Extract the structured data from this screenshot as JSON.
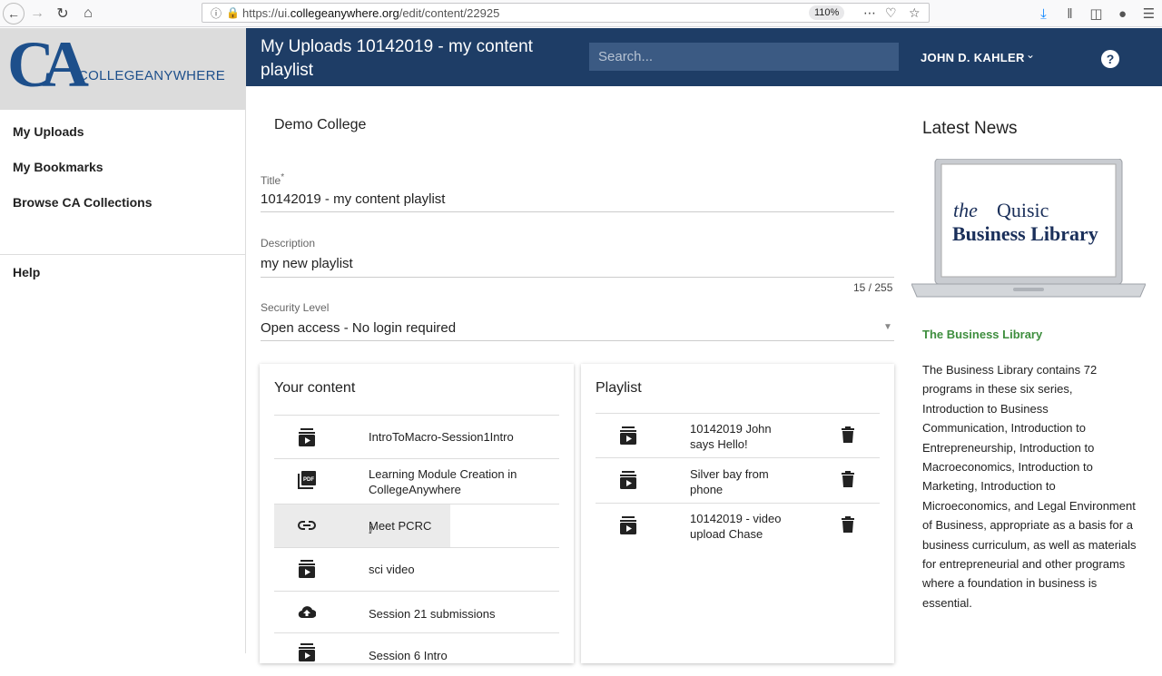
{
  "browser": {
    "url_prefix": "https://ui.",
    "url_domain": "collegeanywhere.org",
    "url_path": "/edit/content/22925",
    "zoom": "110%"
  },
  "sidebar": {
    "logo_letters": "CA",
    "logo_text": "COLLEGEANYWHERE",
    "items": [
      {
        "label": "My Uploads"
      },
      {
        "label": "My Bookmarks"
      },
      {
        "label": "Browse CA Collections"
      },
      {
        "label": "Help"
      }
    ]
  },
  "header": {
    "title": "My Uploads 10142019 - my content playlist",
    "search_placeholder": "Search...",
    "user": "JOHN D. KAHLER",
    "help": "?"
  },
  "form": {
    "college": "Demo College",
    "title_label": "Title",
    "title_required": "*",
    "title_value": "10142019 - my content playlist",
    "description_label": "Description",
    "description_value": "my new playlist",
    "description_counter": "15 / 255",
    "security_label": "Security Level",
    "security_value": "Open access - No login required"
  },
  "your_content": {
    "title": "Your content",
    "items": [
      {
        "label": "IntroToMacro-Session1Intro",
        "icon": "video-stack-icon"
      },
      {
        "label": "Learning Module Creation in CollegeAnywhere",
        "icon": "pdf-icon"
      },
      {
        "label": "Meet PCRC",
        "icon": "link-icon"
      },
      {
        "label": "sci video",
        "icon": "video-stack-icon"
      },
      {
        "label": "Session 21 submissions",
        "icon": "cloud-upload-icon"
      },
      {
        "label": "Session 6 Intro",
        "icon": "video-stack-icon"
      }
    ]
  },
  "playlist": {
    "title": "Playlist",
    "items": [
      {
        "label": "10142019 John says Hello!"
      },
      {
        "label": "Silver bay from phone"
      },
      {
        "label": "10142019 - video upload Chase"
      }
    ]
  },
  "news": {
    "title": "Latest News",
    "image_line1_a": "the",
    "image_line1_b": "Quisic",
    "image_line2": "Business Library",
    "link": "The Business Library",
    "body": "The Business Library contains 72 programs in these six series, Introduction to Business Communication, Introduction to Entrepreneurship, Introduction to Macroeconomics, Introduction to Marketing, Introduction to Microeconomics, and Legal Environment of Business, appropriate as a basis for a business curriculum, as well as materials for entrepreneurial and other programs where a foundation in business is essential."
  },
  "colors": {
    "header": "#1e3d66",
    "brand": "#1d4f8b",
    "news_link": "#3e8e3e"
  }
}
